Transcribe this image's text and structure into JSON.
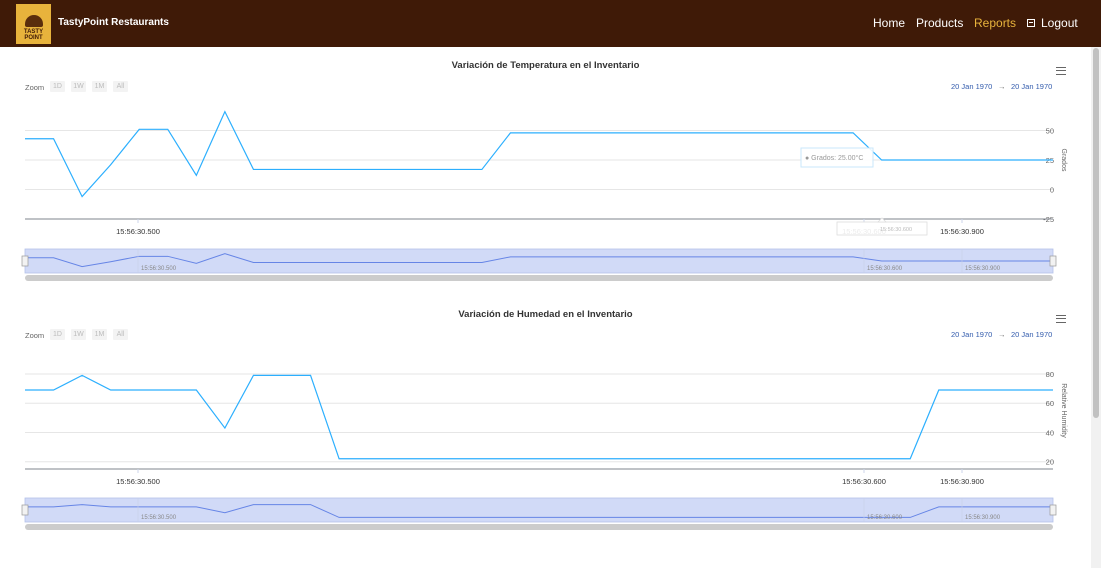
{
  "navbar": {
    "logo_text": [
      "TASTY",
      "POINT"
    ],
    "brand": "TastyPoint Restaurants",
    "links": {
      "home": "Home",
      "products": "Products",
      "reports": "Reports",
      "logout": "Logout"
    },
    "active": "Reports",
    "background": "#3f1a07",
    "accent": "#e8b33c"
  },
  "charts": {
    "temperature": {
      "zoom_label": "Zoom",
      "zoom_buttons": [
        "1D",
        "1W",
        "1M",
        "All"
      ],
      "range_from": "20 Jan 1970",
      "range_arrow": "→",
      "range_to": "20 Jan 1970",
      "tooltip": "● Grados: 25.00°C",
      "crosshair_label": "15:56:30.600"
    },
    "humidity": {
      "zoom_label": "Zoom",
      "zoom_buttons": [
        "1D",
        "1W",
        "1M",
        "All"
      ],
      "range_from": "20 Jan 1970",
      "range_arrow": "→",
      "range_to": "20 Jan 1970"
    }
  },
  "chart_data": [
    {
      "type": "line",
      "title": "Variación de Temperatura en el Inventario",
      "ylabel": "Grados",
      "xlabel": "",
      "ylim": [
        -25,
        75
      ],
      "yticks": [
        -25,
        0,
        25,
        50
      ],
      "xticks": [
        "15:56:30.500",
        "15:56:30.600",
        "15:56:30.900"
      ],
      "navigator_xticks": [
        "15:56:30.500",
        "15:56:30.600",
        "15:56:30.900"
      ],
      "series": [
        {
          "color": "#2caffe",
          "x": [
            0,
            5,
            10,
            15,
            20,
            25,
            30,
            35,
            40,
            80,
            85,
            140,
            145,
            150,
            155,
            160,
            180
          ],
          "y": [
            43,
            43,
            -6,
            21,
            51,
            51,
            12,
            66,
            17,
            17,
            48,
            48,
            48,
            25,
            25,
            25,
            25
          ]
        }
      ],
      "grid": true
    },
    {
      "type": "line",
      "title": "Variación de Humedad en el Inventario",
      "ylabel": "Relative Humidity",
      "xlabel": "",
      "ylim": [
        15,
        95
      ],
      "yticks": [
        20,
        40,
        60,
        80
      ],
      "xticks": [
        "15:56:30.500",
        "15:56:30.600",
        "15:56:30.900"
      ],
      "navigator_xticks": [
        "15:56:30.500",
        "15:56:30.600",
        "15:56:30.900"
      ],
      "series": [
        {
          "color": "#2caffe",
          "x": [
            0,
            5,
            10,
            15,
            20,
            25,
            30,
            35,
            40,
            45,
            50,
            55,
            140,
            145,
            150,
            155,
            160,
            180
          ],
          "y": [
            69,
            69,
            79,
            69,
            69,
            69,
            69,
            43,
            79,
            79,
            79,
            22,
            22,
            22,
            22,
            22,
            69,
            69
          ]
        }
      ],
      "grid": true
    }
  ]
}
